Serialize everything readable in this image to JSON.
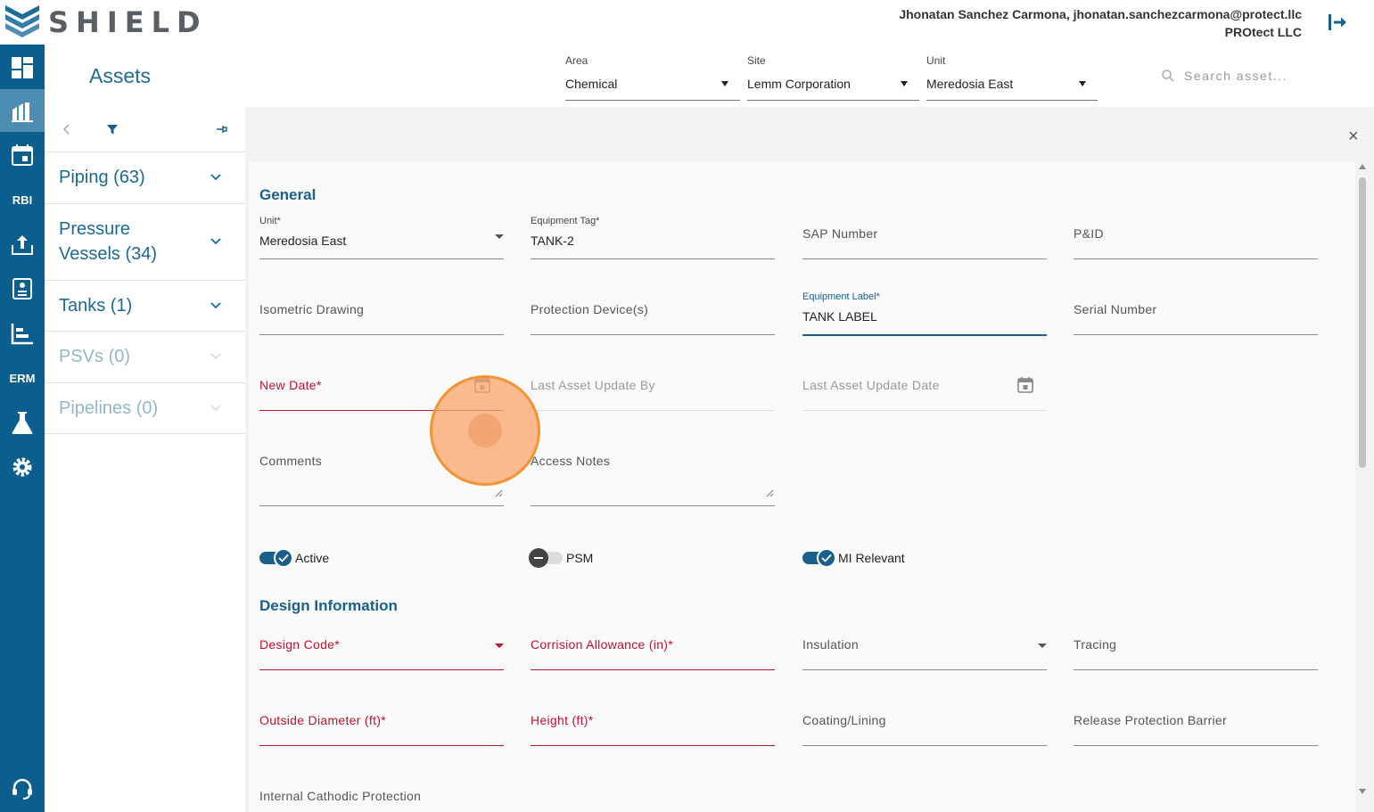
{
  "brand": {
    "name": "SHIELD"
  },
  "user": {
    "line1": "Jhonatan Sanchez Carmona, jhonatan.sanchezcarmona@protect.llc",
    "company": "PROtect LLC"
  },
  "nav": {
    "rbi": "RBI",
    "erm": "ERM"
  },
  "page": {
    "title": "Assets"
  },
  "filters": {
    "area": {
      "label": "Area",
      "value": "Chemical"
    },
    "site": {
      "label": "Site",
      "value": "Lemm Corporation"
    },
    "unit": {
      "label": "Unit",
      "value": "Meredosia East"
    },
    "search_placeholder": "Search asset..."
  },
  "categories": [
    {
      "line1": "Piping (63)",
      "line2": ""
    },
    {
      "line1": "Pressure",
      "line2": "Vessels (34)"
    },
    {
      "line1": "Tanks (1)",
      "line2": ""
    },
    {
      "line1": "PSVs (0)",
      "line2": ""
    },
    {
      "line1": "Pipelines (0)",
      "line2": ""
    }
  ],
  "form": {
    "general_title": "General",
    "unit": {
      "label": "Unit*",
      "value": "Meredosia East"
    },
    "equipment_tag": {
      "label": "Equipment Tag*",
      "value": "TANK-2"
    },
    "sap_number": "SAP Number",
    "pid": "P&ID",
    "isometric_drawing": "Isometric Drawing",
    "protection_devices": "Protection Device(s)",
    "equipment_label": {
      "label": "Equipment Label*",
      "value": "TANK LABEL"
    },
    "serial_number": "Serial Number",
    "new_date": "New Date*",
    "last_update_by": "Last Asset Update By",
    "last_update_date": "Last Asset Update Date",
    "comments": "Comments",
    "access_notes": "Access Notes",
    "toggles": {
      "active": "Active",
      "psm": "PSM",
      "mi_relevant": "MI Relevant"
    },
    "design_title": "Design Information",
    "design_code": "Design Code*",
    "corrosion_allowance": "Corrision Allowance (in)*",
    "insulation": "Insulation",
    "tracing": "Tracing",
    "outside_diameter": "Outside Diameter (ft)*",
    "height": "Height (ft)*",
    "coating": "Coating/Lining",
    "release_barrier": "Release Protection Barrier",
    "internal_cathodic": "Internal Cathodic Protection"
  },
  "colors": {
    "primary": "#0b5f8e",
    "error": "#c4112f",
    "highlight": "#f39332"
  },
  "toggle_state": {
    "active": true,
    "psm": false,
    "mi_relevant": true
  }
}
